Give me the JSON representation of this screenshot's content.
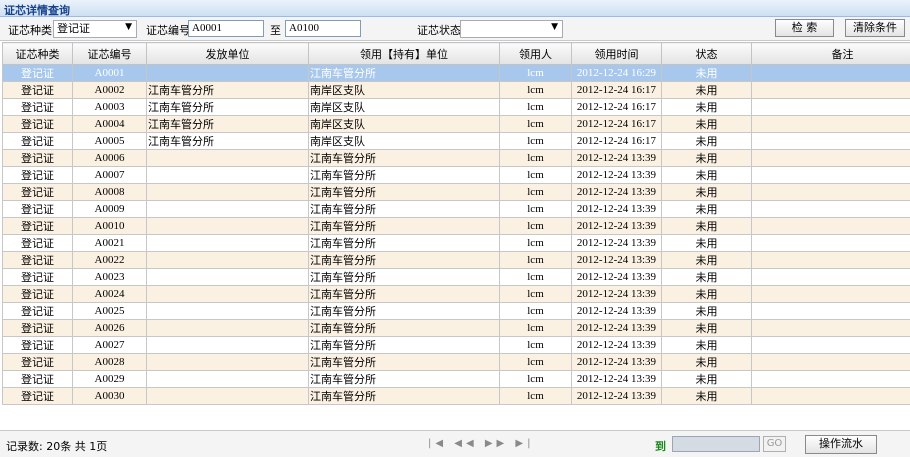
{
  "window": {
    "title": "证芯详情查询"
  },
  "filters": {
    "type_label": "证芯种类",
    "type_value": "登记证",
    "number_label": "证芯编号",
    "number_from": "A0001",
    "to_label": "至",
    "number_to": "A0100",
    "status_label": "证芯状态",
    "status_value": "",
    "search_label": "检  索",
    "clear_label": "清除条件"
  },
  "table": {
    "columns": [
      "证芯种类",
      "证芯编号",
      "发放单位",
      "领用【持有】单位",
      "领用人",
      "领用时间",
      "状态",
      "备注"
    ],
    "rows": [
      [
        "登记证",
        "A0001",
        "",
        "江南车管分所",
        "lcm",
        "2012-12-24 16:29",
        "未用",
        ""
      ],
      [
        "登记证",
        "A0002",
        "江南车管分所",
        "南岸区支队",
        "lcm",
        "2012-12-24 16:17",
        "未用",
        ""
      ],
      [
        "登记证",
        "A0003",
        "江南车管分所",
        "南岸区支队",
        "lcm",
        "2012-12-24 16:17",
        "未用",
        ""
      ],
      [
        "登记证",
        "A0004",
        "江南车管分所",
        "南岸区支队",
        "lcm",
        "2012-12-24 16:17",
        "未用",
        ""
      ],
      [
        "登记证",
        "A0005",
        "江南车管分所",
        "南岸区支队",
        "lcm",
        "2012-12-24 16:17",
        "未用",
        ""
      ],
      [
        "登记证",
        "A0006",
        "",
        "江南车管分所",
        "lcm",
        "2012-12-24 13:39",
        "未用",
        ""
      ],
      [
        "登记证",
        "A0007",
        "",
        "江南车管分所",
        "lcm",
        "2012-12-24 13:39",
        "未用",
        ""
      ],
      [
        "登记证",
        "A0008",
        "",
        "江南车管分所",
        "lcm",
        "2012-12-24 13:39",
        "未用",
        ""
      ],
      [
        "登记证",
        "A0009",
        "",
        "江南车管分所",
        "lcm",
        "2012-12-24 13:39",
        "未用",
        ""
      ],
      [
        "登记证",
        "A0010",
        "",
        "江南车管分所",
        "lcm",
        "2012-12-24 13:39",
        "未用",
        ""
      ],
      [
        "登记证",
        "A0021",
        "",
        "江南车管分所",
        "lcm",
        "2012-12-24 13:39",
        "未用",
        ""
      ],
      [
        "登记证",
        "A0022",
        "",
        "江南车管分所",
        "lcm",
        "2012-12-24 13:39",
        "未用",
        ""
      ],
      [
        "登记证",
        "A0023",
        "",
        "江南车管分所",
        "lcm",
        "2012-12-24 13:39",
        "未用",
        ""
      ],
      [
        "登记证",
        "A0024",
        "",
        "江南车管分所",
        "lcm",
        "2012-12-24 13:39",
        "未用",
        ""
      ],
      [
        "登记证",
        "A0025",
        "",
        "江南车管分所",
        "lcm",
        "2012-12-24 13:39",
        "未用",
        ""
      ],
      [
        "登记证",
        "A0026",
        "",
        "江南车管分所",
        "lcm",
        "2012-12-24 13:39",
        "未用",
        ""
      ],
      [
        "登记证",
        "A0027",
        "",
        "江南车管分所",
        "lcm",
        "2012-12-24 13:39",
        "未用",
        ""
      ],
      [
        "登记证",
        "A0028",
        "",
        "江南车管分所",
        "lcm",
        "2012-12-24 13:39",
        "未用",
        ""
      ],
      [
        "登记证",
        "A0029",
        "",
        "江南车管分所",
        "lcm",
        "2012-12-24 13:39",
        "未用",
        ""
      ],
      [
        "登记证",
        "A0030",
        "",
        "江南车管分所",
        "lcm",
        "2012-12-24 13:39",
        "未用",
        ""
      ]
    ],
    "selected_row": 0
  },
  "footer": {
    "record_count": "记录数: 20条  共 1页",
    "goto_label": "到",
    "goto_value": "",
    "go_label": "GO",
    "operation_label": "操作流水"
  },
  "colors": {
    "selected_row": "#a7c8ec",
    "alt_row": "#fbf1e2",
    "title_text": "#15428b"
  }
}
